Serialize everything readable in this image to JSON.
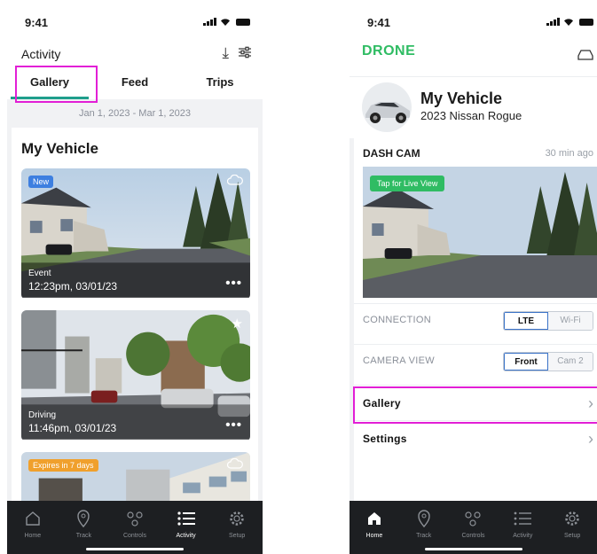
{
  "left": {
    "status_time": "9:41",
    "header_title": "Activity",
    "tabs": [
      "Gallery",
      "Feed",
      "Trips"
    ],
    "date_range": "Jan 1, 2023 - Mar 1, 2023",
    "section_title": "My Vehicle",
    "cards": [
      {
        "badge": "New",
        "badge_color": "#3d7fe0",
        "line1": "Event",
        "line2": "12:23pm, 03/01/23",
        "more": "•••"
      },
      {
        "badge": "",
        "line1": "Driving",
        "line2": "11:46pm, 03/01/23",
        "more": "•••"
      },
      {
        "badge": "Expires in 7 days",
        "badge_color": "#f0a02c",
        "line1": "",
        "line2": "",
        "more": ""
      }
    ],
    "nav": [
      "Home",
      "Track",
      "Controls",
      "Activity",
      "Setup"
    ],
    "nav_active": "Activity"
  },
  "right": {
    "status_time": "9:41",
    "brand": "DRONE",
    "vehicle_name": "My Vehicle",
    "vehicle_model": "2023 Nissan Rogue",
    "dashcam_title": "DASH CAM",
    "dashcam_time": "30 min ago",
    "live_label": "Tap for Live View",
    "connection_label": "CONNECTION",
    "connection_options": [
      "LTE",
      "Wi-Fi"
    ],
    "camera_label": "CAMERA VIEW",
    "camera_options": [
      "Front",
      "Cam 2"
    ],
    "gallery_label": "Gallery",
    "settings_label": "Settings",
    "nav": [
      "Home",
      "Track",
      "Controls",
      "Activity",
      "Setup"
    ],
    "nav_active": "Home"
  },
  "colors": {
    "accent_green": "#2fbc63",
    "tab_underline": "#1f9e8c",
    "highlight": "#e21fd6",
    "nav_bg": "#1d1f22"
  }
}
